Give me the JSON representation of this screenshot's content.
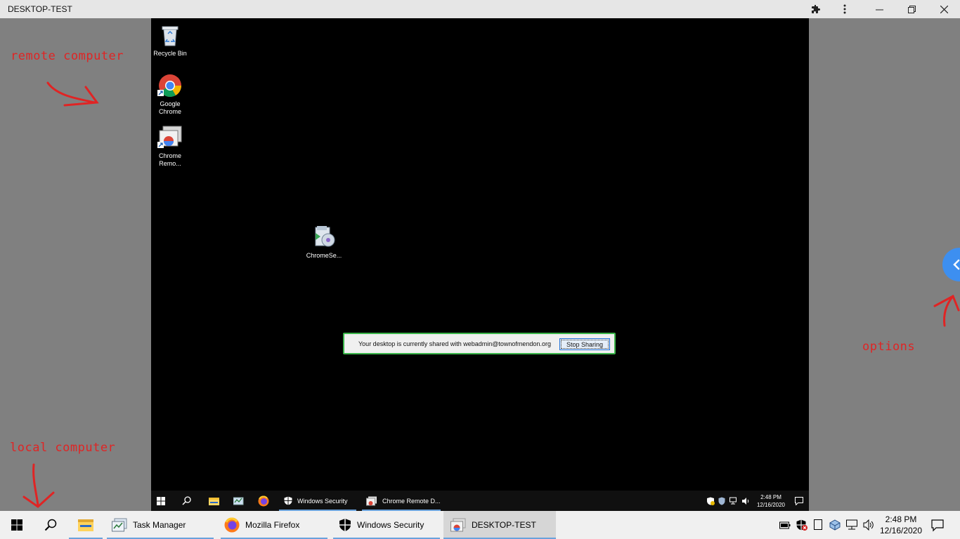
{
  "window": {
    "title": "DESKTOP-TEST"
  },
  "remote_desktop": {
    "icons": [
      {
        "label": "Recycle Bin"
      },
      {
        "label": "Google Chrome"
      },
      {
        "label": "Chrome Remo..."
      },
      {
        "label": "ChromeSe..."
      }
    ],
    "share_bar": {
      "message": "Your desktop is currently shared with webadmin@townofmendon.org",
      "stop_label": "Stop Sharing"
    },
    "taskbar": {
      "items": [
        {
          "label": "Windows Security"
        },
        {
          "label": "Chrome Remote D..."
        }
      ],
      "time": "2:48 PM",
      "date": "12/16/2020"
    }
  },
  "annotations": {
    "remote": "remote computer",
    "local": "local computer",
    "options": "options"
  },
  "taskbar": {
    "items": [
      {
        "label": "Task Manager"
      },
      {
        "label": "Mozilla Firefox"
      },
      {
        "label": "Windows Security"
      },
      {
        "label": "DESKTOP-TEST"
      }
    ],
    "time": "2:48 PM",
    "date": "12/16/2020"
  },
  "colors": {
    "share_border": "#3bb54a",
    "options_handle": "#3d8ff0",
    "annotation": "#e02424",
    "taskbar_accent": "#6aa2dc"
  }
}
